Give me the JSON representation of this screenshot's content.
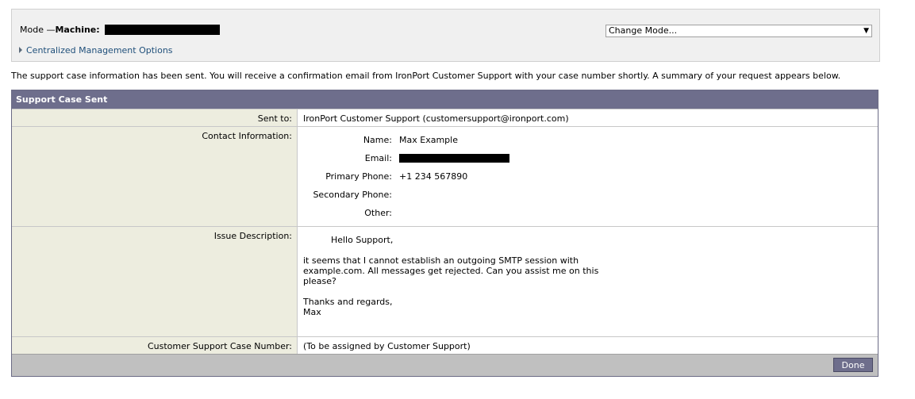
{
  "mode_bar": {
    "mode_label": "Mode —",
    "machine_label": "Machine:",
    "centralized_link": "Centralized Management Options",
    "change_mode": "Change Mode...",
    "arrow_icon": "chevron-down-icon"
  },
  "message": "The support case information has been sent. You will receive a confirmation email from IronPort Customer Support with your case number shortly. A summary of your request appears below.",
  "panel": {
    "title": "Support Case Sent",
    "sent_to_label": "Sent to:",
    "sent_to_value": "IronPort Customer Support (customersupport@ironport.com)",
    "contact_label": "Contact Information:",
    "contact": {
      "name_label": "Name:",
      "name_value": "Max Example",
      "email_label": "Email:",
      "primary_label": "Primary Phone:",
      "primary_value": "+1 234 567890",
      "secondary_label": "Secondary Phone:",
      "other_label": "Other:"
    },
    "issue_label": "Issue Description:",
    "issue_text": "          Hello Support,\n\nit seems that I cannot establish an outgoing SMTP session with\nexample.com. All messages get rejected. Can you assist me on this\nplease?\n\nThanks and regards,\nMax",
    "case_label": "Customer Support Case Number:",
    "case_value": "(To be assigned by Customer Support)",
    "done_label": "Done"
  },
  "colors": {
    "panel_header": "#6e6e8c",
    "label_cell": "#ededdf",
    "link": "#1f4f7a"
  }
}
